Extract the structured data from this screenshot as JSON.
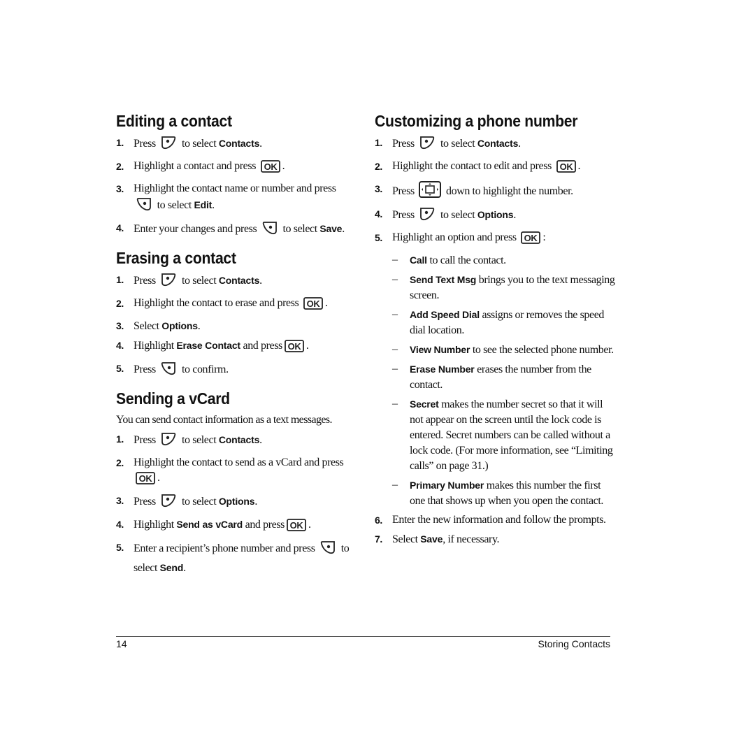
{
  "left_column": {
    "editing": {
      "title": "Editing a contact",
      "steps": [
        {
          "n": "1.",
          "pre": "Press",
          "key": "right-softkey-icon",
          "post": "to select",
          "ui": "Contacts",
          "end": "."
        },
        {
          "n": "2.",
          "pre": "Highlight a contact and press",
          "key": "ok-key-icon",
          "end": "."
        },
        {
          "n": "3.",
          "pre": "Highlight the contact name or number and press",
          "key": "left-softkey-icon",
          "post": "to select",
          "ui": "Edit",
          "end": "."
        },
        {
          "n": "4.",
          "pre": "Enter your changes and press",
          "key": "left-softkey-icon",
          "post": "to select",
          "ui": "Save",
          "end": "."
        }
      ]
    },
    "erasing": {
      "title": "Erasing a contact",
      "steps": [
        {
          "n": "1.",
          "pre": "Press",
          "key": "right-softkey-icon",
          "post": "to select",
          "ui": "Contacts",
          "end": "."
        },
        {
          "n": "2.",
          "pre": "Highlight the contact to erase and press",
          "key": "ok-key-icon",
          "end": "."
        },
        {
          "n": "3.",
          "pre": "Select",
          "ui": "Options",
          "end": "."
        },
        {
          "n": "4.",
          "pre": "Highlight",
          "ui": "Erase Contact",
          "post": "and press",
          "key": "ok-key-icon",
          "end": "."
        },
        {
          "n": "5.",
          "pre": "Press",
          "key": "left-softkey-icon",
          "post": "to confirm."
        }
      ]
    },
    "vcard": {
      "title": "Sending a vCard",
      "intro": "You can send contact information as a text messages.",
      "steps": [
        {
          "n": "1.",
          "pre": "Press",
          "key": "right-softkey-icon",
          "post": "to select",
          "ui": "Contacts",
          "end": "."
        },
        {
          "n": "2.",
          "pre": "Highlight the contact to send as a vCard and press",
          "key": "ok-key-icon",
          "end": "."
        },
        {
          "n": "3.",
          "pre": "Press",
          "key": "right-softkey-icon",
          "post": "to select",
          "ui": "Options",
          "end": "."
        },
        {
          "n": "4.",
          "pre": "Highlight",
          "ui": "Send as vCard",
          "post": "and press",
          "key": "ok-key-icon",
          "end": "."
        },
        {
          "n": "5.",
          "pre": "Enter a recipient’s phone number and press",
          "key": "left-softkey-icon",
          "post": "to select",
          "ui": "Send",
          "end": "."
        }
      ]
    }
  },
  "right_column": {
    "customizing": {
      "title": "Customizing a phone number",
      "steps": [
        {
          "n": "1.",
          "pre": "Press",
          "key": "right-softkey-icon",
          "post": "to select",
          "ui": "Contacts",
          "end": "."
        },
        {
          "n": "2.",
          "pre": "Highlight the contact to edit and press",
          "key": "ok-key-icon",
          "end": "."
        },
        {
          "n": "3.",
          "pre": "Press",
          "key": "nav-key-icon",
          "post": "down to highlight the number."
        },
        {
          "n": "4.",
          "pre": "Press",
          "key": "right-softkey-icon",
          "post": "to select",
          "ui": "Options",
          "end": "."
        },
        {
          "n": "5.",
          "pre": "Highlight an option and press",
          "key": "ok-key-icon",
          "end": ":"
        }
      ],
      "options": [
        {
          "dash": "–",
          "ui": "Call",
          "text": "to call the contact."
        },
        {
          "dash": "–",
          "ui": "Send Text Msg",
          "text": "brings you to the text messaging screen."
        },
        {
          "dash": "–",
          "ui": "Add Speed Dial",
          "text": "assigns or removes the speed dial location."
        },
        {
          "dash": "–",
          "ui": "View Number",
          "text": "to see the selected phone number."
        },
        {
          "dash": "–",
          "ui": "Erase Number",
          "text": "erases the number from the contact."
        },
        {
          "dash": "–",
          "ui": "Secret",
          "text": "makes the number secret so that it will not appear on the screen until the lock code is entered. Secret numbers can be called without a lock code. (For more information, see “Limiting calls” on page 31.)"
        },
        {
          "dash": "–",
          "ui": "Primary Number",
          "text": "makes this number the first one that shows up when you open the contact."
        }
      ],
      "steps_after": [
        {
          "n": "6.",
          "pre": "Enter the new information and follow the prompts."
        },
        {
          "n": "7.",
          "pre": "Select",
          "ui": "Save",
          "post": ", if necessary."
        }
      ]
    }
  },
  "footer": {
    "page_number": "14",
    "chapter_title": "Storing Contacts"
  }
}
